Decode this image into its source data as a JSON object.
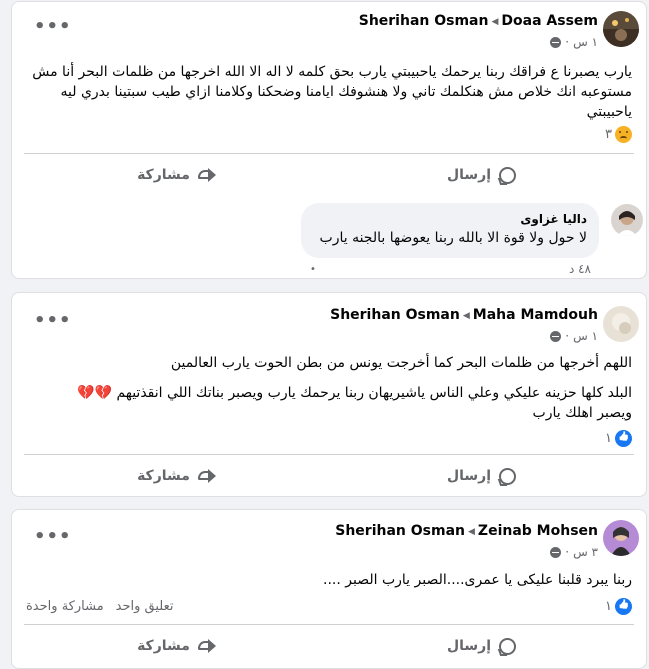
{
  "posts": [
    {
      "author": "Sherihan Osman",
      "target": "Doaa Assem",
      "time": "١ س",
      "text": "يارب يصبرنا ع فراقك ربنا يرحمك ياحبيبتي يارب بحق كلمه لا اله الا الله اخرجها من ظلمات البحر أنا مش مستوعبه انك خلاص مش هنكلمك تاني ولا هنشوفك ايامنا وضحكنا وكلامنا ازاي طيب سبتينا بدري ليه ياحبيبتي",
      "reaction_count": "٣",
      "reaction": "sad-icon",
      "send_label": "إرسال",
      "share_label": "مشاركة",
      "comment": {
        "name": "داليا غزاوى",
        "text": "لا حول ولا قوة الا بالله ربنا يعوضها بالجنه يارب",
        "time": "٤٨ د"
      }
    },
    {
      "author": "Sherihan Osman",
      "target": "Maha Mamdouh",
      "time": "١ س",
      "text1": "اللهم أخرجها من ظلمات البحر كما أخرجت يونس من بطن الحوت يارب العالمين",
      "text2": "البلد كلها حزينه عليكي وعلي الناس ياشيريهان ربنا يرحمك يارب ويصبر بناتك اللي انقذتيهم",
      "text2_emoji": "💔💔",
      "text3": "ويصبر اهلك يارب",
      "reaction_count": "١",
      "reaction": "like-icon",
      "send_label": "إرسال",
      "share_label": "مشاركة"
    },
    {
      "author": "Sherihan Osman",
      "target": "Zeinab Mohsen",
      "time": "٣ س",
      "text": "ربنا يبرد قلبنا عليكى يا عمرى....الصبر يارب الصبر ....",
      "reaction_count": "١",
      "reaction": "like-icon",
      "comments_label": "تعليق واحد",
      "shares_label": "مشاركة واحدة",
      "send_label": "إرسال",
      "share_label": "مشاركة"
    }
  ],
  "colors": {
    "accent": "#1877f2",
    "muted": "#65676b",
    "bg": "#f0f2f5"
  }
}
